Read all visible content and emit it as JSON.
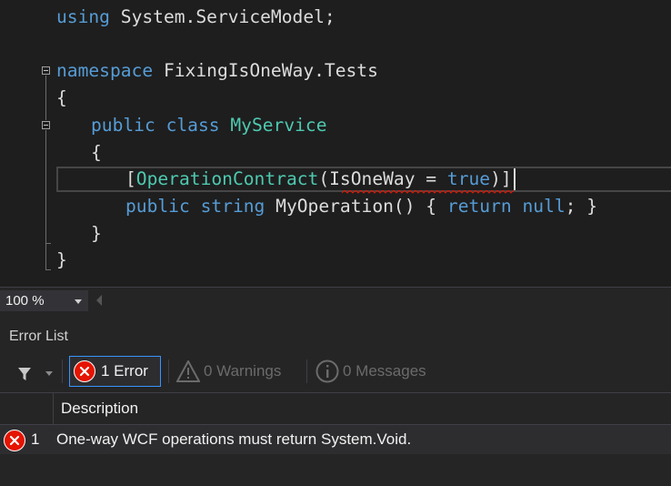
{
  "editor": {
    "lines": {
      "using": {
        "kw": "using",
        "rest": " System.ServiceModel;"
      },
      "namespace": {
        "kw": "namespace",
        "rest": " FixingIsOneWay.Tests"
      },
      "brace_open_ns": "{",
      "class": {
        "kw1": "public",
        "kw2": " class",
        "type": " MyService"
      },
      "brace_open_class": "{",
      "attribute": {
        "open": "[",
        "type": "OperationContract",
        "paren": "(",
        "arg": "IsOneWay",
        "eq": " = ",
        "val": "true",
        "close": ")]"
      },
      "method": {
        "kw1": "public",
        "kw2": " string",
        "name": " MyOperation() { ",
        "kw3": "return",
        "kw4": " null",
        "end": "; }"
      },
      "brace_close_class": "}",
      "brace_close_ns": "}"
    }
  },
  "zoom": {
    "level": "100 %"
  },
  "error_list": {
    "title": "Error List",
    "errors_label": "1 Error",
    "warnings_label": "0 Warnings",
    "messages_label": "0 Messages",
    "columns": {
      "description": "Description"
    },
    "rows": [
      {
        "number": "1",
        "description": "One-way WCF operations must return System.Void."
      }
    ]
  },
  "colors": {
    "keyword": "#569cd6",
    "type": "#4ec9b0",
    "error": "#e51400",
    "text": "#dcdcdc",
    "accent": "#3794ff"
  }
}
